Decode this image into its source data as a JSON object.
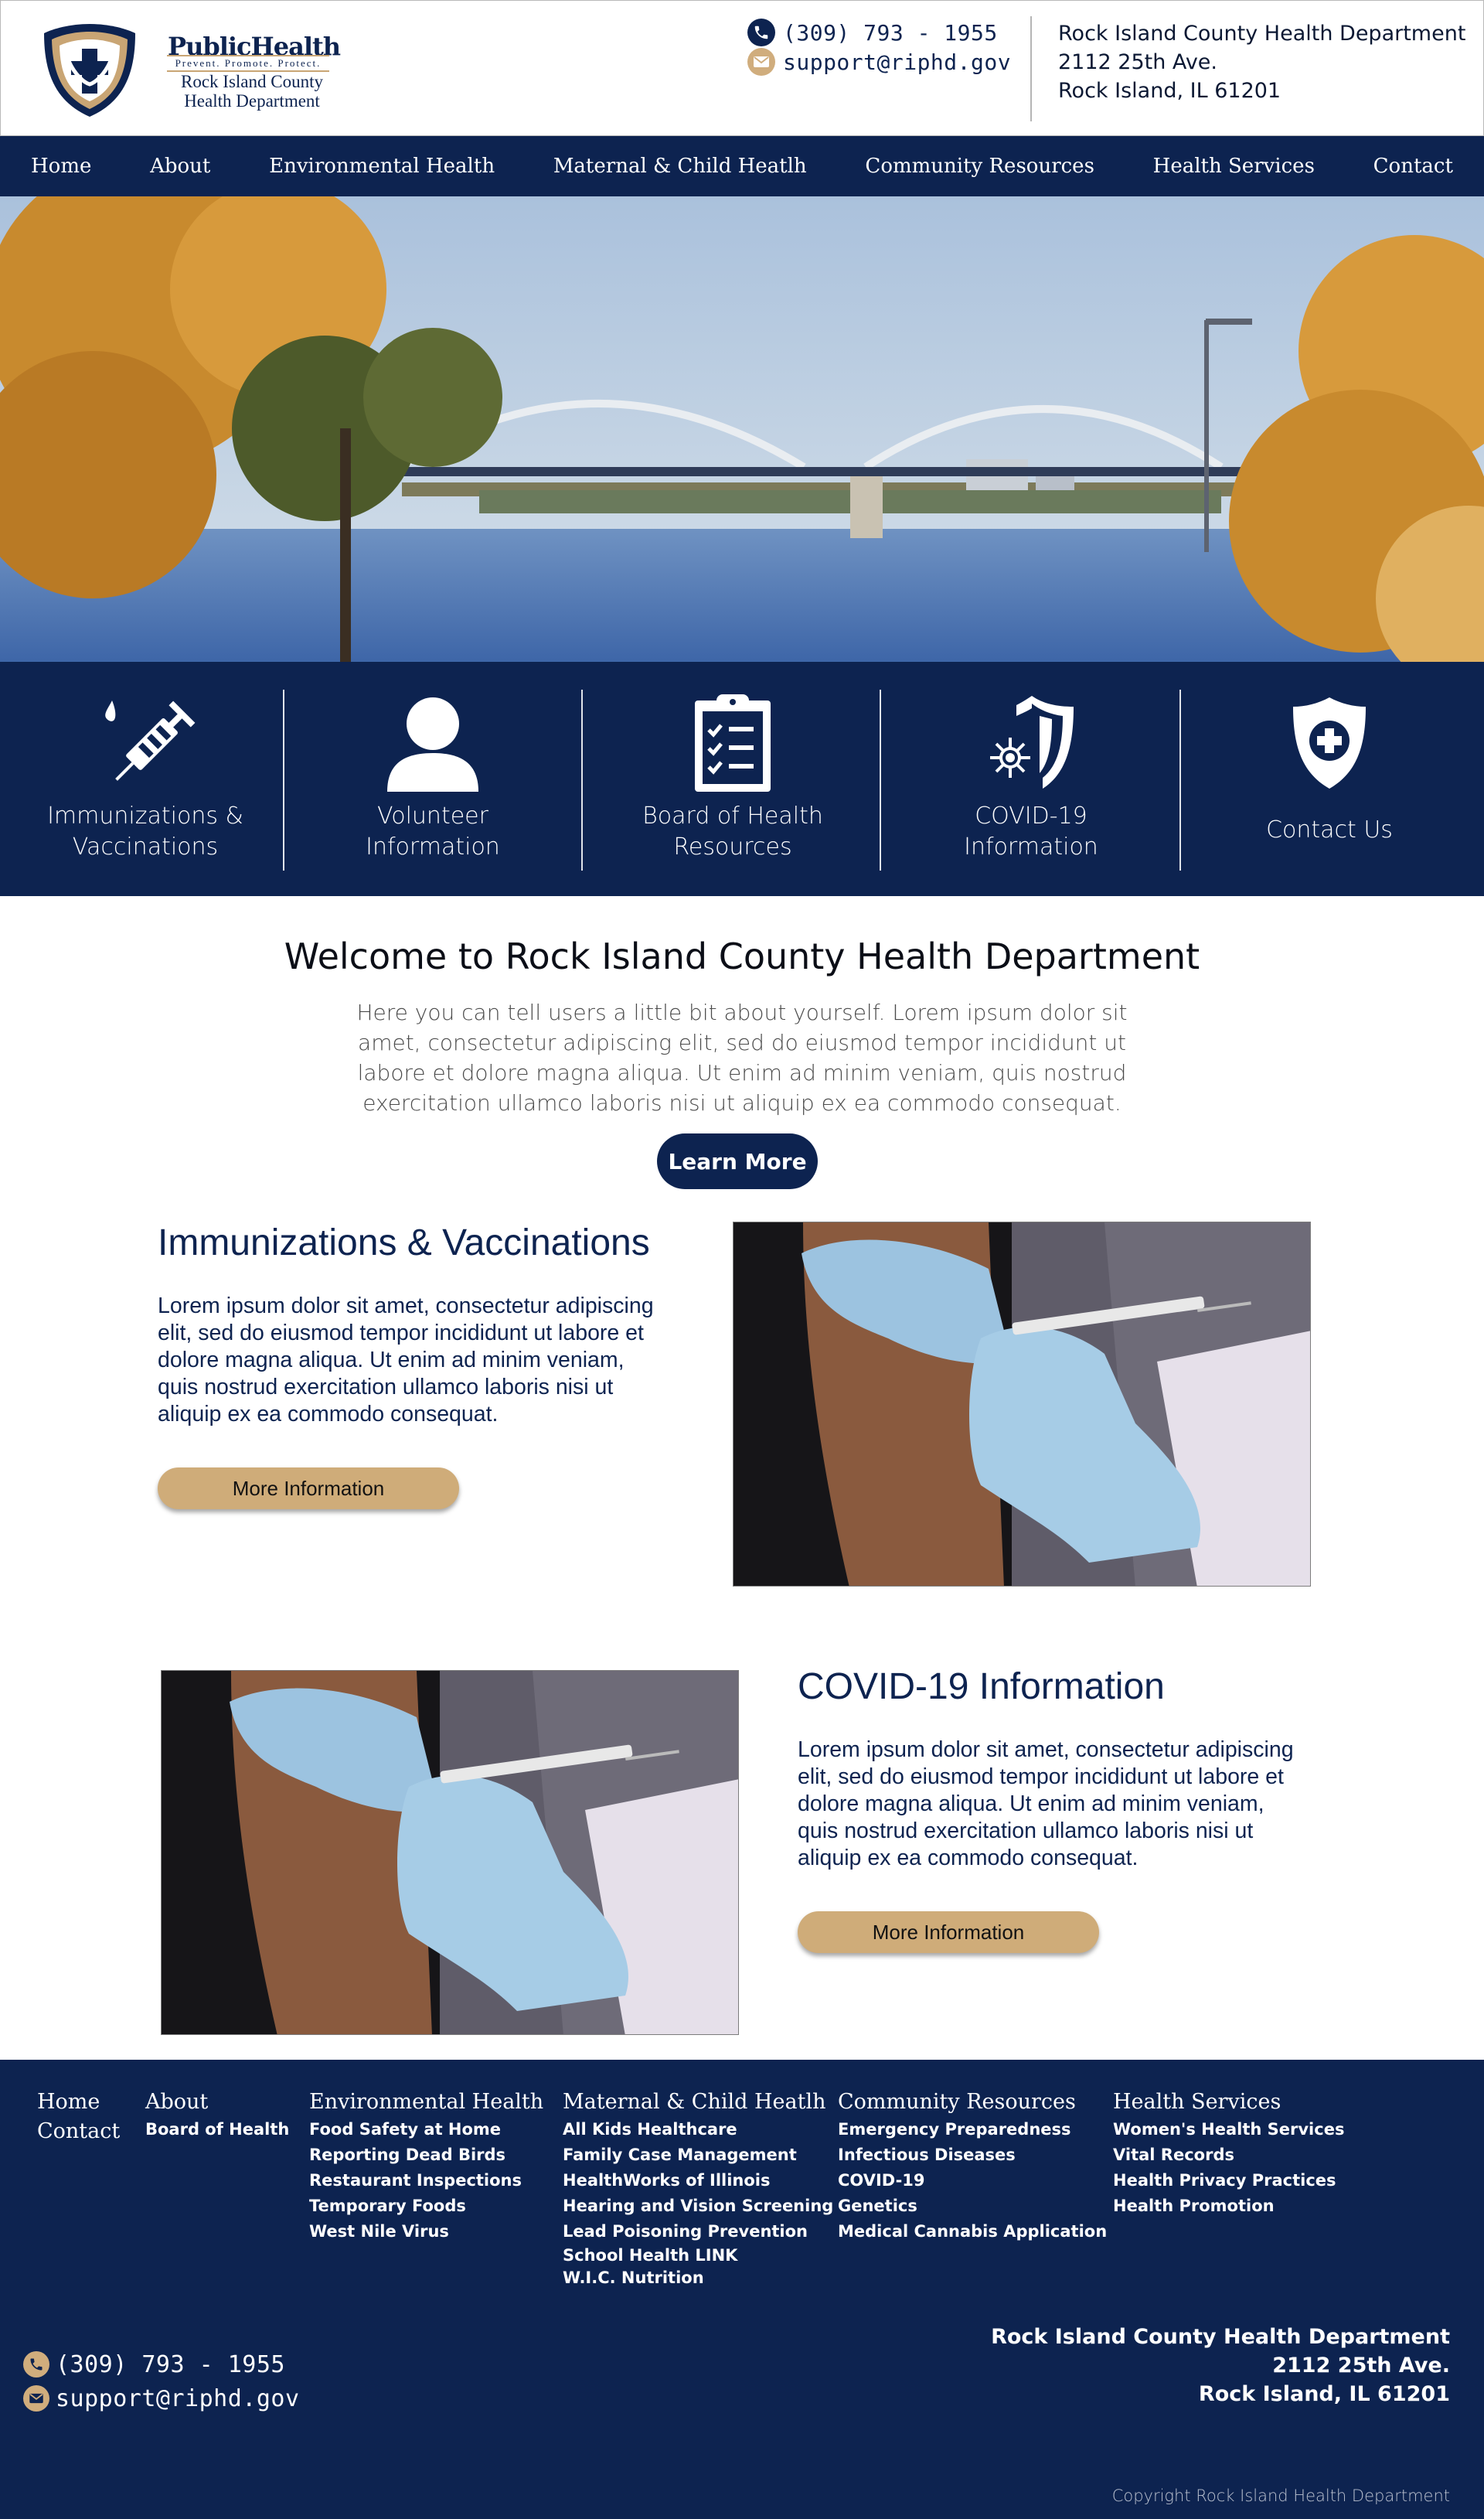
{
  "header": {
    "logo": {
      "title": "PublicHealth",
      "tagline": "Prevent. Promote. Protect.",
      "subtitle_line1": "Rock Island County",
      "subtitle_line2": "Health Department",
      "icon": "shield-cross-icon"
    },
    "phone": "(309) 793 - 1955",
    "email": "support@riphd.gov",
    "address": {
      "line1": "Rock Island County Health Department",
      "line2": "2112 25th Ave.",
      "line3": "Rock Island, IL 61201"
    }
  },
  "nav": {
    "items": [
      {
        "label": "Home"
      },
      {
        "label": "About"
      },
      {
        "label": "Environmental Health"
      },
      {
        "label": "Maternal & Child Heatlh"
      },
      {
        "label": "Community Resources"
      },
      {
        "label": "Health Services"
      },
      {
        "label": "Contact"
      }
    ]
  },
  "quick_links": [
    {
      "line1": "Immunizations &",
      "line2": "Vaccinations",
      "icon": "syringe-icon"
    },
    {
      "line1": "Volunteer",
      "line2": "Information",
      "icon": "person-icon"
    },
    {
      "line1": "Board of Health",
      "line2": "Resources",
      "icon": "clipboard-checklist-icon"
    },
    {
      "line1": "COVID-19",
      "line2": "Information",
      "icon": "virus-shield-icon"
    },
    {
      "line1": "Contact Us",
      "line2": "",
      "icon": "shield-plus-icon"
    }
  ],
  "welcome": {
    "title": "Welcome to Rock Island County Health Department",
    "body": "Here you can tell users a little bit about yourself. Lorem ipsum dolor sit amet, consectetur adipiscing elit, sed do eiusmod tempor incididunt ut labore et dolore magna aliqua. Ut enim ad minim veniam, quis nostrud exercitation ullamco laboris nisi ut aliquip ex ea commodo consequat.",
    "button": "Learn More"
  },
  "sections": [
    {
      "title": "Immunizations & Vaccinations",
      "body": "Lorem ipsum dolor sit amet, consectetur adipiscing elit, sed do eiusmod tempor incididunt ut labore et dolore magna aliqua. Ut enim ad minim veniam, quis nostrud exercitation ullamco laboris nisi ut aliquip ex ea commodo consequat.",
      "button": "More Information"
    },
    {
      "title": "COVID-19 Information",
      "body": "Lorem ipsum dolor sit amet, consectetur adipiscing elit, sed do eiusmod tempor incididunt ut labore et dolore magna aliqua. Ut enim ad minim veniam, quis nostrud exercitation ullamco laboris nisi ut aliquip ex ea commodo consequat.",
      "button": "More Information"
    }
  ],
  "footer": {
    "columns": [
      {
        "heading": "Home",
        "heading2": "Contact",
        "links": []
      },
      {
        "heading": "About",
        "links": [
          "Board of Health"
        ]
      },
      {
        "heading": "Environmental Health",
        "links": [
          "Food Safety at Home",
          "Reporting Dead Birds",
          "Restaurant Inspections",
          "Temporary Foods",
          "West Nile Virus"
        ]
      },
      {
        "heading": "Maternal & Child Heatlh",
        "links": [
          "All Kids Healthcare",
          "Family Case Management",
          "HealthWorks of Illinois",
          "Hearing and Vision Screening",
          "Lead Poisoning Prevention",
          "School Health LINK",
          "W.I.C. Nutrition"
        ]
      },
      {
        "heading": "Community Resources",
        "links": [
          "Emergency Preparedness",
          "Infectious Diseases",
          "COVID-19",
          "Genetics",
          "Medical Cannabis Application"
        ]
      },
      {
        "heading": "Health Services",
        "links": [
          "Women's Health Services",
          "Vital Records",
          "Health Privacy Practices",
          "Health Promotion"
        ]
      }
    ],
    "phone": "(309) 793 - 1955",
    "email": "support@riphd.gov",
    "address": {
      "line1": "Rock Island County Health Department",
      "line2": "2112 25th Ave.",
      "line3": "Rock Island, IL 61201"
    },
    "copyright": "Copyright Rock Island Health Department"
  },
  "colors": {
    "navy": "#0d2350",
    "gold": "#cfac79",
    "white": "#ffffff"
  }
}
